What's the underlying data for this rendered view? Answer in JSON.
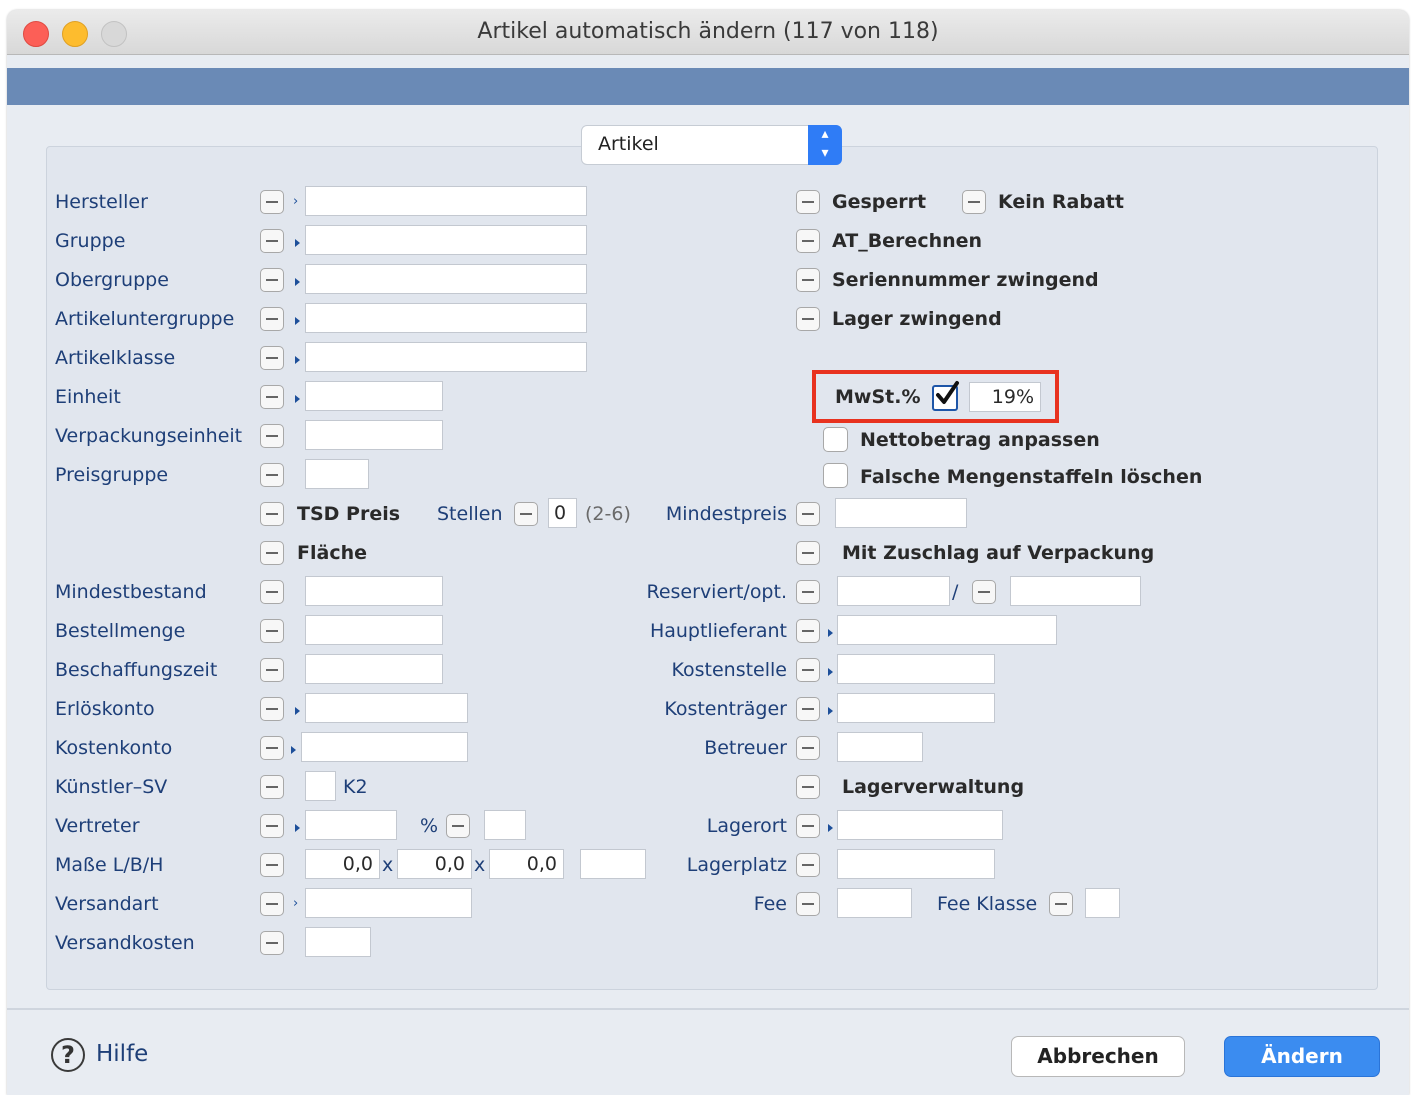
{
  "window": {
    "title": "Artikel automatisch ändern (117 von 118)"
  },
  "dropdown": {
    "value": "Artikel"
  },
  "left_fields": {
    "hersteller": "Hersteller",
    "gruppe": "Gruppe",
    "obergruppe": "Obergruppe",
    "artikeluntergruppe": "Artikeluntergruppe",
    "artikelklasse": "Artikelklasse",
    "einheit": "Einheit",
    "verpackungseinheit": "Verpackungseinheit",
    "preisgruppe": "Preisgruppe",
    "mindestbestand": "Mindestbestand",
    "bestellmenge": "Bestellmenge",
    "beschaffungszeit": "Beschaffungszeit",
    "erloeskonto": "Erlöskonto",
    "kostenkonto": "Kostenkonto",
    "kuenstler_sv": "Künstler–SV",
    "vertreter": "Vertreter",
    "masse": "Maße L/B/H",
    "versandart": "Versandart",
    "versandkosten": "Versandkosten"
  },
  "k2_label": "K2",
  "percent_label": "%",
  "masse_values": {
    "l": "0,0",
    "b": "0,0",
    "h": "0,0",
    "x": "x"
  },
  "tsd": {
    "label": "TSD Preis",
    "stellen_label": "Stellen",
    "stellen_value": "0",
    "range": "(2-6)",
    "mindestpreis_label": "Mindestpreis"
  },
  "flaeche_label": "Fläche",
  "mit_zuschlag_label": "Mit Zuschlag auf Verpackung",
  "flags": {
    "gesperrt": "Gesperrt",
    "kein_rabatt": "Kein Rabatt",
    "at_berechnen": "AT_Berechnen",
    "seriennummer": "Seriennummer zwingend",
    "lager": "Lager zwingend"
  },
  "mwst": {
    "label": "MwSt.%",
    "checked": true,
    "value": "19%"
  },
  "checkboxes": {
    "nettobetrag": "Nettobetrag anpassen",
    "falsche_mengen": "Falsche Mengenstaffeln löschen"
  },
  "right_fields": {
    "reserviert": "Reserviert/opt.",
    "slash": "/",
    "hauptlieferant": "Hauptlieferant",
    "kostenstelle": "Kostenstelle",
    "kostentraeger": "Kostenträger",
    "betreuer": "Betreuer",
    "lagerverwaltung": "Lagerverwaltung",
    "lagerort": "Lagerort",
    "lagerplatz": "Lagerplatz",
    "fee": "Fee",
    "fee_klasse": "Fee Klasse"
  },
  "footer": {
    "help": "Hilfe",
    "help_icon": "?",
    "cancel": "Abbrechen",
    "ok": "Ändern"
  },
  "colors": {
    "accent": "#2f7cf6",
    "highlight": "#e8321f",
    "blue_bar": "#6a8ab6"
  }
}
